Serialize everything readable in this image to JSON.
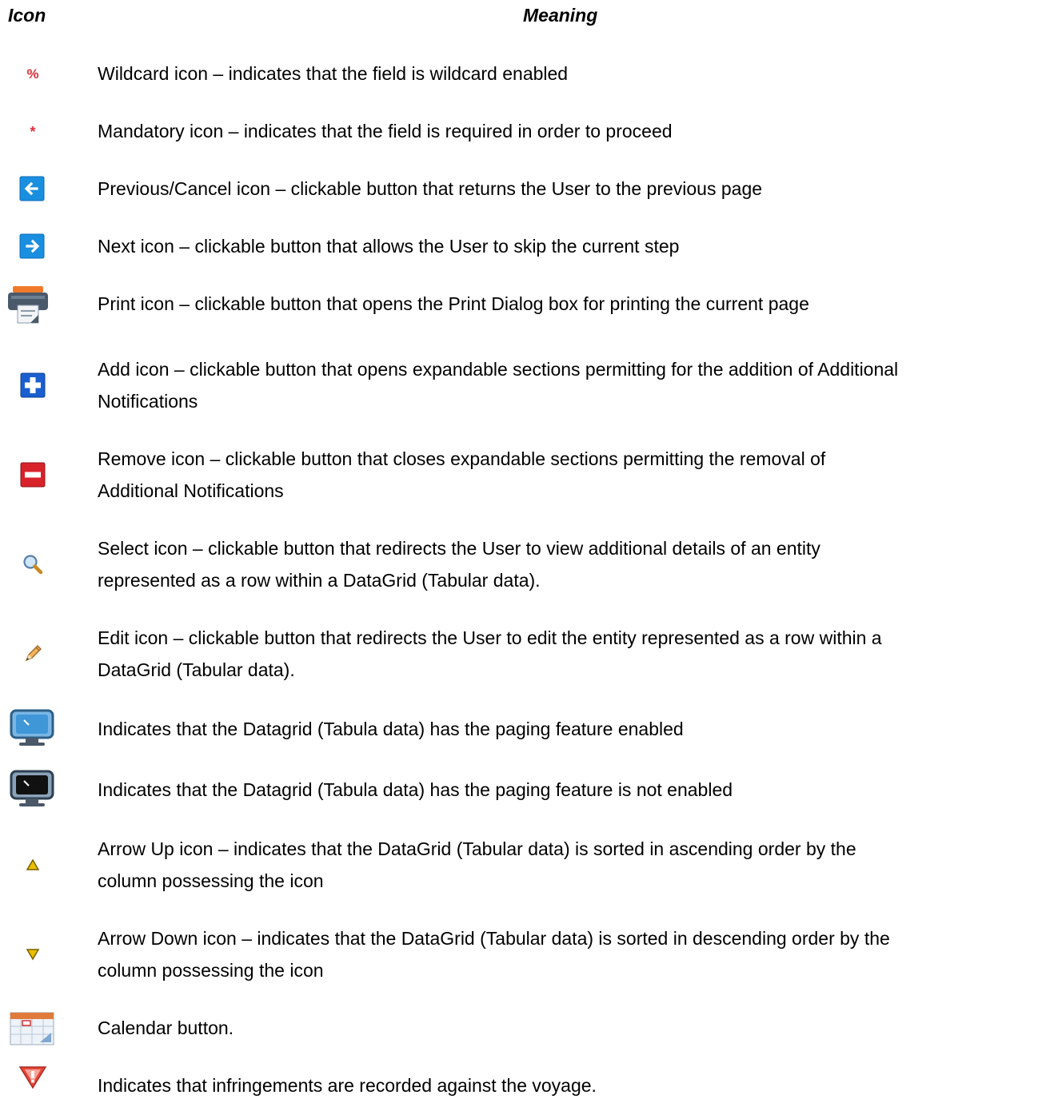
{
  "headers": {
    "icon": "Icon",
    "meaning": "Meaning"
  },
  "rows": [
    {
      "icon": "wildcard-icon",
      "lines": [
        "Wildcard icon – indicates that the field is wildcard enabled"
      ]
    },
    {
      "icon": "mandatory-icon",
      "lines": [
        "Mandatory icon – indicates that the field is required in order to proceed"
      ]
    },
    {
      "icon": "previous-arrow-icon",
      "lines": [
        "Previous/Cancel icon – clickable button that returns the User to the previous page"
      ]
    },
    {
      "icon": "next-arrow-icon",
      "lines": [
        "Next icon – clickable button that allows the User to skip the current step"
      ]
    },
    {
      "icon": "printer-icon",
      "lines": [
        "Print icon – clickable button that opens the Print Dialog box for printing the current page"
      ]
    },
    {
      "icon": "plus-icon",
      "lines": [
        "Add icon – clickable button that opens expandable sections permitting for the addition of Additional",
        "Notifications"
      ]
    },
    {
      "icon": "minus-icon",
      "lines": [
        "Remove icon – clickable button that closes expandable sections permitting the removal of",
        "Additional Notifications"
      ]
    },
    {
      "icon": "magnifier-icon",
      "lines": [
        "Select icon – clickable button that redirects the User to view additional details of an entity",
        "represented as a row within a DataGrid (Tabular data)."
      ]
    },
    {
      "icon": "pencil-icon",
      "lines": [
        "Edit icon – clickable button that redirects the User to edit the entity represented as a row within a",
        "DataGrid (Tabular data)."
      ]
    },
    {
      "icon": "monitor-paging-enabled-icon",
      "lines": [
        "Indicates that the Datagrid (Tabula data) has the paging feature enabled"
      ]
    },
    {
      "icon": "monitor-paging-disabled-icon",
      "lines": [
        "Indicates that the Datagrid (Tabula data) has the paging feature is not enabled"
      ]
    },
    {
      "icon": "arrow-up-icon",
      "lines": [
        "Arrow Up icon – indicates that the DataGrid (Tabular data) is sorted in ascending order by the",
        "column possessing the icon"
      ]
    },
    {
      "icon": "arrow-down-icon",
      "lines": [
        "Arrow Down icon – indicates that the DataGrid (Tabular data) is sorted in descending order by the",
        "column possessing the icon"
      ]
    },
    {
      "icon": "calendar-icon",
      "lines": [
        "Calendar button."
      ]
    },
    {
      "icon": "warning-shield-icon",
      "lines": [
        "Indicates that infringements are recorded against the voyage."
      ]
    }
  ],
  "colors": {
    "wildcard": "#e0303a",
    "blue_button": "#1a8fe0",
    "add": "#1a5fcf",
    "remove": "#d8232a",
    "sort_arrow": "#e8c000"
  }
}
